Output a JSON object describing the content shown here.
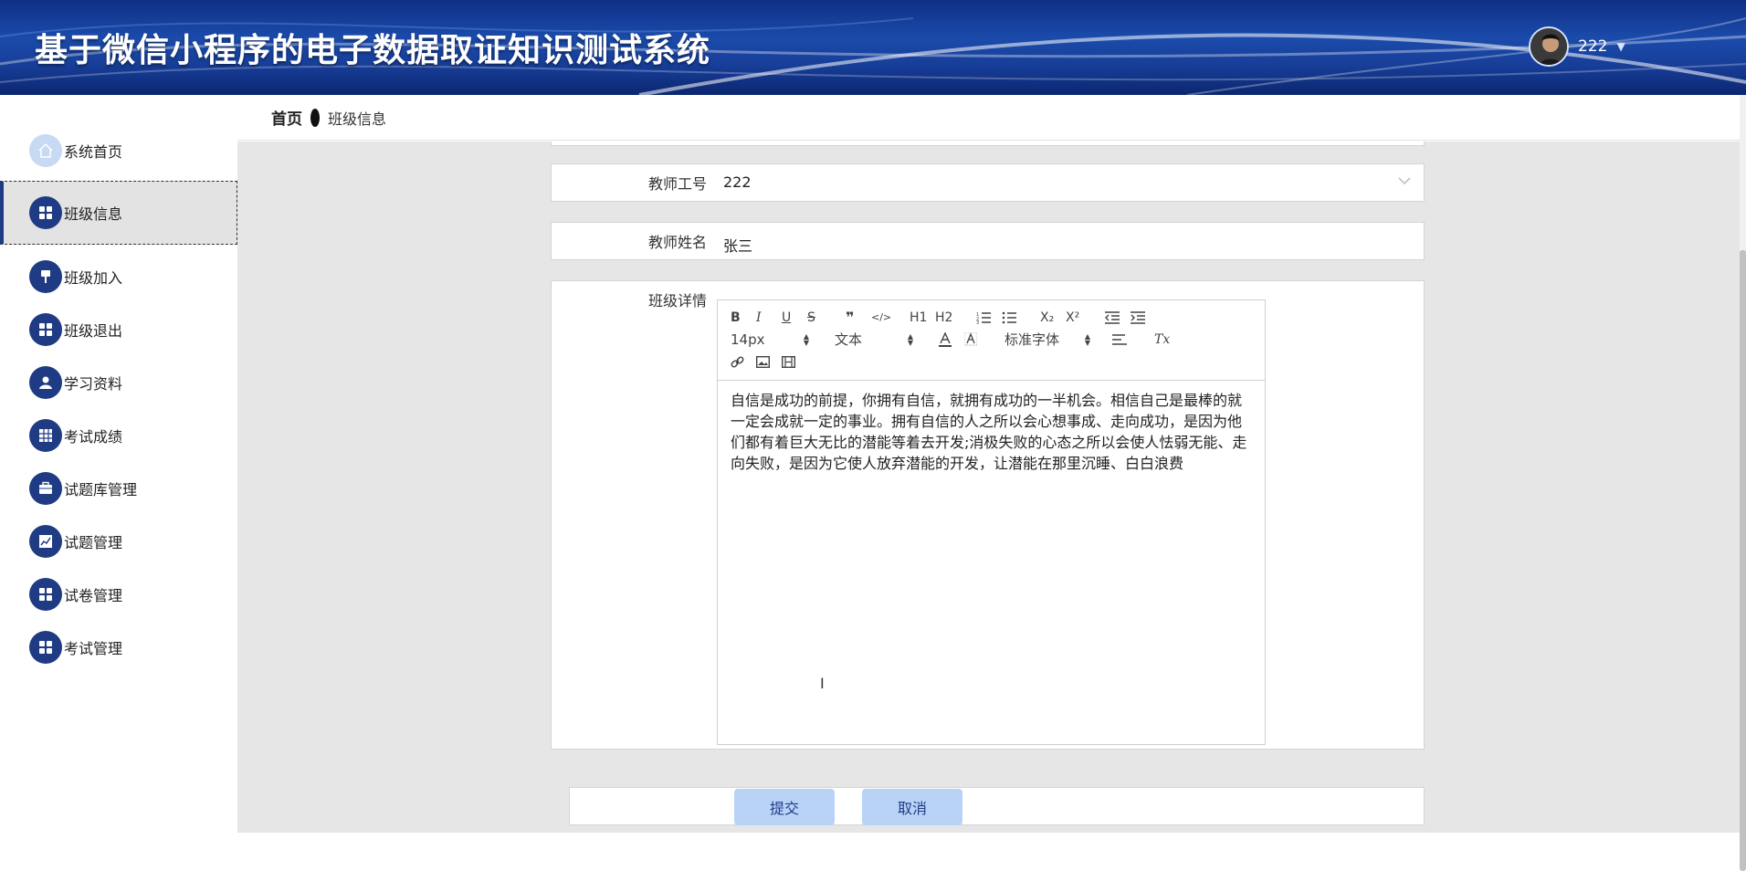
{
  "header": {
    "title": "基于微信小程序的电子数据取证知识测试系统",
    "username": "222",
    "caret": "▼"
  },
  "breadcrumb": {
    "home": "首页",
    "current": "班级信息"
  },
  "sidebar": {
    "items": [
      {
        "label": "系统首页",
        "icon": "home-icon",
        "active": false
      },
      {
        "label": "班级信息",
        "icon": "grid-icon",
        "active": true
      },
      {
        "label": "班级加入",
        "icon": "pin-icon",
        "active": false
      },
      {
        "label": "班级退出",
        "icon": "grid-icon",
        "active": false
      },
      {
        "label": "学习资料",
        "icon": "user-icon",
        "active": false
      },
      {
        "label": "考试成绩",
        "icon": "table-icon",
        "active": false
      },
      {
        "label": "试题库管理",
        "icon": "briefcase-icon",
        "active": false
      },
      {
        "label": "试题管理",
        "icon": "chart-icon",
        "active": false
      },
      {
        "label": "试卷管理",
        "icon": "grid-icon",
        "active": false
      },
      {
        "label": "考试管理",
        "icon": "grid-icon",
        "active": false
      }
    ]
  },
  "form": {
    "teacher_id": {
      "label": "教师工号",
      "value": "222"
    },
    "teacher_name": {
      "label": "教师姓名",
      "value": "张三"
    },
    "class_detail": {
      "label": "班级详情",
      "content": "自信是成功的前提，你拥有自信，就拥有成功的一半机会。相信自己是最棒的就一定会成就一定的事业。拥有自信的人之所以会心想事成、走向成功，是因为他们都有着巨大无比的潜能等着去开发;消极失败的心态之所以会使人怯弱无能、走向失败，是因为它使人放弃潜能的开发，让潜能在那里沉睡、白白浪费"
    }
  },
  "editor": {
    "toolbar_row1": [
      "B",
      "I",
      "U",
      "S",
      "❞",
      "</>",
      "H1",
      "H2",
      "ordered-list-icon",
      "bullet-list-icon",
      "X₂",
      "X²",
      "outdent-icon",
      "indent-icon"
    ],
    "size_select": "14px",
    "header_select": "文本",
    "font_select": "标准字体",
    "clear_format": "Tx"
  },
  "actions": {
    "submit": "提交",
    "cancel": "取消"
  },
  "colors": {
    "header_dark": "#0f2f86",
    "nav_icon": "#1e3b84",
    "button_bg": "#b9d3f6",
    "main_bg": "#e6e6e6"
  }
}
